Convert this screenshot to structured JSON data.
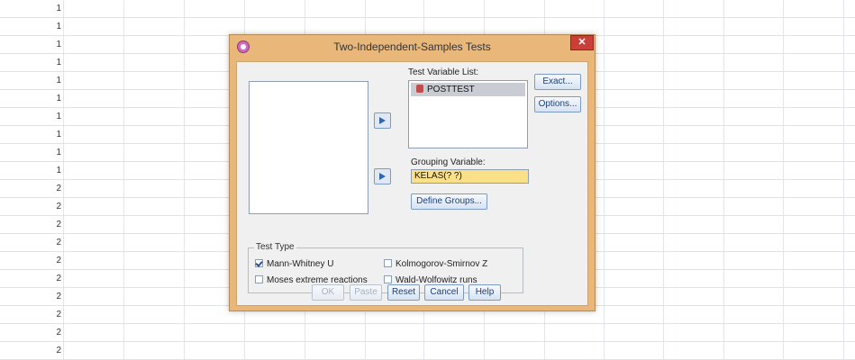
{
  "sheet": {
    "row_numbers": [
      "1",
      "1",
      "1",
      "1",
      "1",
      "1",
      "1",
      "1",
      "1",
      "1",
      "2",
      "2",
      "2",
      "2",
      "2",
      "2",
      "2",
      "2",
      "2",
      "2"
    ]
  },
  "dialog": {
    "title": "Two-Independent-Samples Tests",
    "close_glyph": "✕",
    "test_variable_list_label": "Test Variable List:",
    "test_variables": [
      "POSTTEST"
    ],
    "grouping_variable_label": "Grouping Variable:",
    "grouping_variable_value": "KELAS(? ?)",
    "define_groups_label": "Define Groups...",
    "exact_label": "Exact...",
    "options_label": "Options...",
    "test_type": {
      "legend": "Test Type",
      "mann_whitney": {
        "label": "Mann-Whitney U",
        "checked": true
      },
      "kolmogorov": {
        "label": "Kolmogorov-Smirnov Z",
        "checked": false
      },
      "moses": {
        "label": "Moses extreme reactions",
        "checked": false
      },
      "wald": {
        "label": "Wald-Wolfowitz runs",
        "checked": false
      }
    },
    "buttons": {
      "ok": "OK",
      "paste": "Paste",
      "reset": "Reset",
      "cancel": "Cancel",
      "help": "Help"
    }
  },
  "colors": {
    "dialog_frame": "#e9b77a",
    "close_button": "#c9403a",
    "grouping_field": "#fbe08a",
    "selected_item": "#c9ccd3"
  }
}
